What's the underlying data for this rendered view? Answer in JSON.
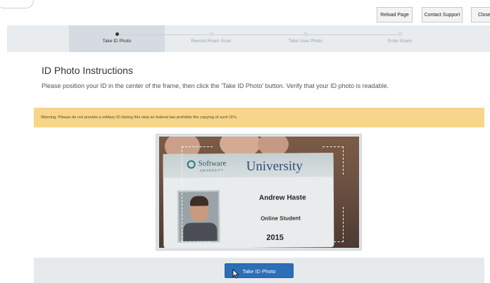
{
  "topbar": {
    "buttons": [
      "Reload Page",
      "Contact Support",
      "Close"
    ]
  },
  "stepper": {
    "steps": [
      {
        "label": "Take ID Photo",
        "active": true
      },
      {
        "label": "Record Room Scan",
        "active": false
      },
      {
        "label": "Take User Photo",
        "active": false
      },
      {
        "label": "Enter Exam",
        "active": false
      }
    ]
  },
  "main": {
    "title": "ID Photo Instructions",
    "instructions": "Please position your ID in the center of the frame, then click the 'Take ID Photo' button. Verify that your ID photo is readable.",
    "warning": "Warning: Please do not provide a military ID during this step as federal law prohibits the copying of such ID's."
  },
  "camera": {
    "card_logo": "Software",
    "card_logo_sub": "UNIVERSITY",
    "card_university": "University",
    "card_name": "Andrew Haste",
    "card_role": "Online Student",
    "card_year": "2015"
  },
  "actions": {
    "take_photo_label": "Take ID Photo"
  },
  "colors": {
    "primary": "#2b6fb6",
    "warning_bg": "#f7d58a",
    "stepper_bg": "#e8ecef"
  }
}
